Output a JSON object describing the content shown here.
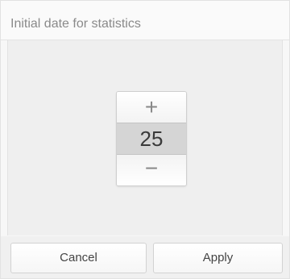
{
  "dialog": {
    "title": "Initial date for statistics"
  },
  "picker": {
    "increment_label": "+",
    "value": "25",
    "decrement_label": "−"
  },
  "buttons": {
    "cancel_label": "Cancel",
    "apply_label": "Apply"
  }
}
